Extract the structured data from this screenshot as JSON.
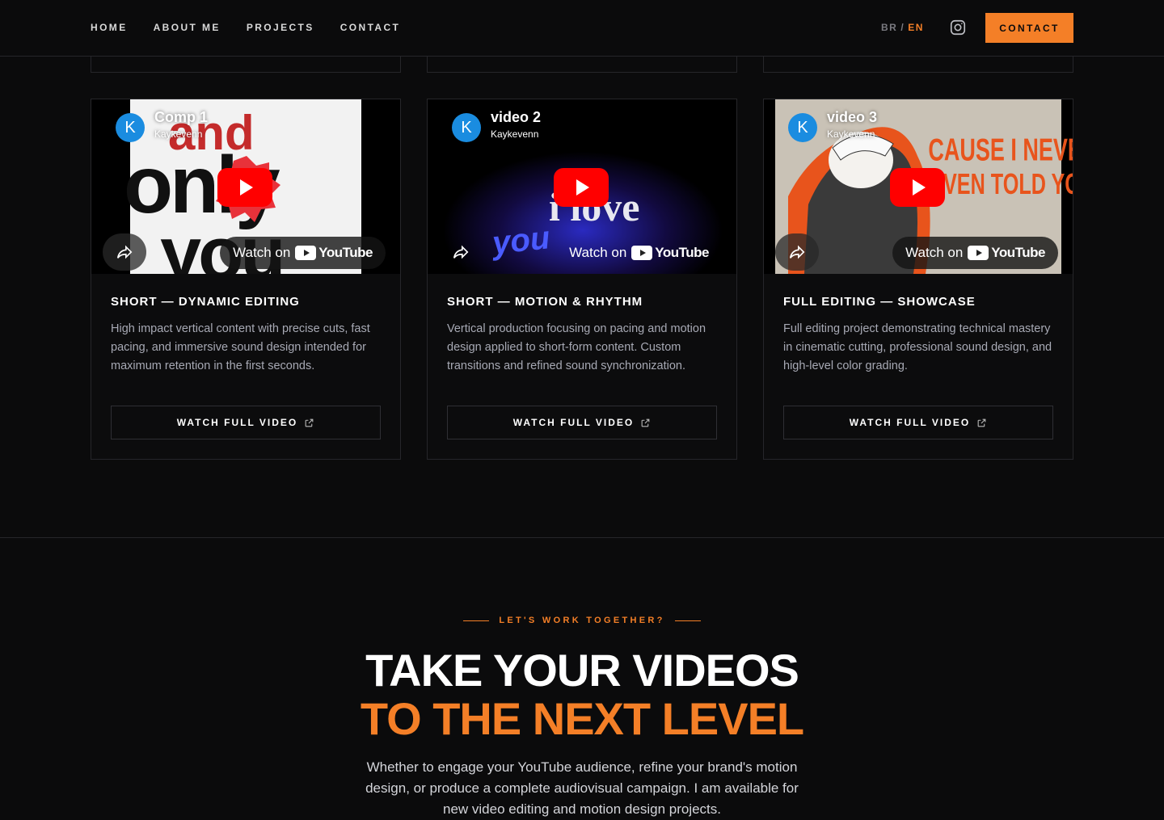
{
  "nav": {
    "links": [
      "HOME",
      "ABOUT ME",
      "PROJECTS",
      "CONTACT"
    ],
    "lang_br": "BR",
    "lang_sep": "/",
    "lang_en": "EN",
    "cta": "CONTACT",
    "accent": "#f47f27"
  },
  "cards": [
    {
      "video_title": "Comp 1",
      "channel": "Kaykevenn",
      "avatar_letter": "K",
      "watch_on": "Watch on",
      "yt_word": "YouTube",
      "title": "SHORT — DYNAMIC EDITING",
      "description": "High impact vertical content with precise cuts, fast pacing, and immersive sound design intended for maximum retention in the first seconds.",
      "button": "WATCH FULL VIDEO"
    },
    {
      "video_title": "video 2",
      "channel": "Kaykevenn",
      "avatar_letter": "K",
      "watch_on": "Watch on",
      "yt_word": "YouTube",
      "title": "SHORT — MOTION & RHYTHM",
      "description": "Vertical production focusing on pacing and motion design applied to short-form content. Custom transitions and refined sound synchronization.",
      "button": "WATCH FULL VIDEO"
    },
    {
      "video_title": "video 3",
      "channel": "Kaykevenn",
      "avatar_letter": "K",
      "watch_on": "Watch on",
      "yt_word": "YouTube",
      "title": "FULL EDITING — SHOWCASE",
      "description": "Full editing project demonstrating technical mastery in cinematic cutting, professional sound design, and high-level color grading.",
      "button": "WATCH FULL VIDEO"
    }
  ],
  "thumb_text": {
    "t1_a": "and",
    "t1_b": "only",
    "t1_c": "you",
    "t2_a": "i love",
    "t2_b": "you",
    "t3_a": "CAUSE I NEVER",
    "t3_b": "EVEN TOLD YOU"
  },
  "cta_section": {
    "eyebrow": "LET'S WORK TOGETHER?",
    "headline_1": "TAKE YOUR VIDEOS",
    "headline_2": "TO THE NEXT LEVEL",
    "description": "Whether to engage your YouTube audience, refine your brand's motion design, or produce a complete audiovisual campaign. I am available for new video editing and motion design projects."
  }
}
